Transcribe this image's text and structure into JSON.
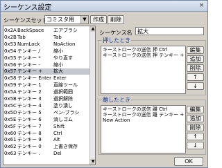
{
  "window": {
    "title": "シーケンス設定",
    "close": "×"
  },
  "sequence_set": {
    "label": "シーケンスセット",
    "value": "コミスタ用",
    "create_label": "作成",
    "delete_label": "削除"
  },
  "sequence_list": {
    "rows": [
      {
        "code": "0x2A",
        "key": "BackSpace",
        "action": "エアブラシ"
      },
      {
        "code": "0x2B",
        "key": "Tab",
        "action": "Tab"
      },
      {
        "code": "0x53",
        "key": "NumLock",
        "action": "NoAction"
      },
      {
        "code": "0x54",
        "key": "テンキー /",
        "action": "縮小"
      },
      {
        "code": "0x55",
        "key": "テンキー *",
        "action": "やり直す"
      },
      {
        "code": "0x56",
        "key": "テンキー -",
        "action": "縮小"
      },
      {
        "code": "0x57",
        "key": "テンキー +",
        "action": "拡大"
      },
      {
        "code": "0x58",
        "key": "テンキー Enter",
        "action": "Enter"
      },
      {
        "code": "0x59",
        "key": "テンキー 1",
        "action": "直線ツール"
      },
      {
        "code": "0x5A",
        "key": "テンキー 2",
        "action": "選択範囲"
      },
      {
        "code": "0x5B",
        "key": "テンキー 3",
        "action": "選択解除"
      },
      {
        "code": "0x5C",
        "key": "テンキー 4",
        "action": "塗り潰し"
      },
      {
        "code": "0x5D",
        "key": "テンキー 5",
        "action": "ペン-ブラシ"
      },
      {
        "code": "0x5E",
        "key": "テンキー 6",
        "action": "消しゴム"
      },
      {
        "code": "0x5F",
        "key": "テンキー 7",
        "action": "Shift"
      },
      {
        "code": "0x60",
        "key": "テンキー 8",
        "action": "Ctrl"
      },
      {
        "code": "0x61",
        "key": "テンキー 9",
        "action": "Alt"
      },
      {
        "code": "0x62",
        "key": "テンキー 0",
        "action": "上書き保存"
      },
      {
        "code": "0x63",
        "key": "テンキー .",
        "action": "Del"
      }
    ],
    "selected_index": 6,
    "scroll_up": "▲",
    "scroll_down": "▼"
  },
  "sequence_name": {
    "label": "シーケンス名",
    "value": "拡大"
  },
  "on_press": {
    "label": "押したとき",
    "lines": [
      "キーストロークの送信 押 Ctrl",
      "キーストロークの送信 押 テンキー +"
    ],
    "edit": "編集",
    "add": "追加",
    "delete": "削除",
    "up": "↑",
    "down": "↓"
  },
  "on_release": {
    "label": "離したとき",
    "lines": [
      "キーストロークの送信 離 Ctrl",
      "キーストロークの送信 離 テンキー +",
      "New Action"
    ],
    "edit": "編集",
    "add": "追加",
    "delete": "削除",
    "up": "↑",
    "down": "↓"
  },
  "footer": {
    "ok": "OK"
  }
}
